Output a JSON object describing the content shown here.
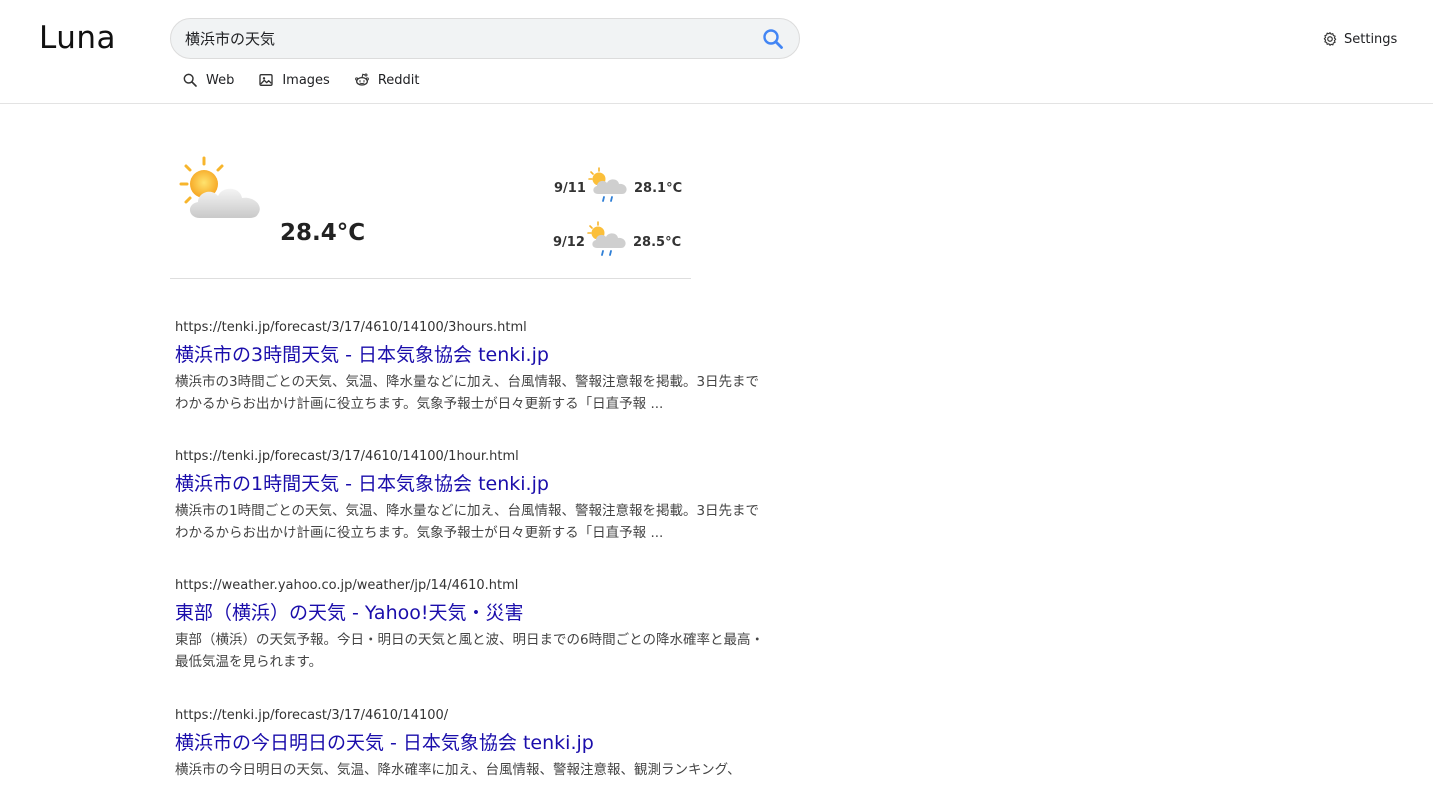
{
  "app": {
    "name": "Luna"
  },
  "search": {
    "query": "横浜市の天気",
    "placeholder": ""
  },
  "settings": {
    "label": "Settings",
    "icon": "gear-icon"
  },
  "tabs": [
    {
      "label": "Web",
      "icon": "search-icon"
    },
    {
      "label": "Images",
      "icon": "image-icon"
    },
    {
      "label": "Reddit",
      "icon": "reddit-icon"
    }
  ],
  "weather": {
    "current": {
      "temp": "28.4°C",
      "icon": "partly-cloudy-icon"
    },
    "forecast": [
      {
        "date": "9/11",
        "temp": "28.1°C",
        "icon": "rain-cloud-sun-icon"
      },
      {
        "date": "9/12",
        "temp": "28.5°C",
        "icon": "rain-cloud-sun-icon"
      }
    ]
  },
  "results": [
    {
      "url": "https://tenki.jp/forecast/3/17/4610/14100/3hours.html",
      "title": "横浜市の3時間天気 - 日本気象協会 tenki.jp",
      "snippet": "横浜市の3時間ごとの天気、気温、降水量などに加え、台風情報、警報注意報を掲載。3日先までわかるからお出かけ計画に役立ちます。気象予報士が日々更新する「日直予報 ..."
    },
    {
      "url": "https://tenki.jp/forecast/3/17/4610/14100/1hour.html",
      "title": "横浜市の1時間天気 - 日本気象協会 tenki.jp",
      "snippet": "横浜市の1時間ごとの天気、気温、降水量などに加え、台風情報、警報注意報を掲載。3日先までわかるからお出かけ計画に役立ちます。気象予報士が日々更新する「日直予報 ..."
    },
    {
      "url": "https://weather.yahoo.co.jp/weather/jp/14/4610.html",
      "title": "東部（横浜）の天気 - Yahoo!天気・災害",
      "snippet": "東部（横浜）の天気予報。今日・明日の天気と風と波、明日までの6時間ごとの降水確率と最高・最低気温を見られます。"
    },
    {
      "url": "https://tenki.jp/forecast/3/17/4610/14100/",
      "title": "横浜市の今日明日の天気 - 日本気象協会 tenki.jp",
      "snippet": "横浜市の今日明日の天気、気温、降水確率に加え、台風情報、警報注意報、観測ランキング、"
    }
  ]
}
